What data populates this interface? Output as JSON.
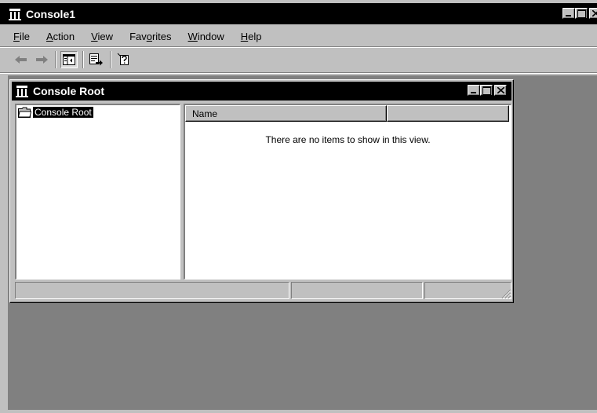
{
  "outer_window": {
    "title": "Console1",
    "controls": [
      "minimize",
      "maximize",
      "close"
    ]
  },
  "menubar": {
    "items": [
      {
        "pre": "",
        "mnemonic": "F",
        "post": "ile"
      },
      {
        "pre": "",
        "mnemonic": "A",
        "post": "ction"
      },
      {
        "pre": "",
        "mnemonic": "V",
        "post": "iew"
      },
      {
        "pre": "Fav",
        "mnemonic": "o",
        "post": "rites"
      },
      {
        "pre": "",
        "mnemonic": "W",
        "post": "indow"
      },
      {
        "pre": "",
        "mnemonic": "H",
        "post": "elp"
      }
    ]
  },
  "toolbar": {
    "icons": [
      "back-arrow-icon",
      "forward-arrow-icon",
      "show-hide-tree-icon",
      "export-list-icon",
      "help-icon"
    ]
  },
  "child_window": {
    "title": "Console Root",
    "tree": {
      "items": [
        {
          "label": "Console Root",
          "icon": "folder-icon",
          "selected": true
        }
      ]
    },
    "list": {
      "columns": [
        "Name",
        ""
      ],
      "empty_message": "There are no items to show in this view."
    },
    "statusbar": {
      "panels": [
        "",
        "",
        ""
      ]
    }
  },
  "colors": {
    "title_bar": "#000000",
    "face": "#c0c0c0",
    "mdi_background": "#808080",
    "pane_background": "#ffffff"
  }
}
